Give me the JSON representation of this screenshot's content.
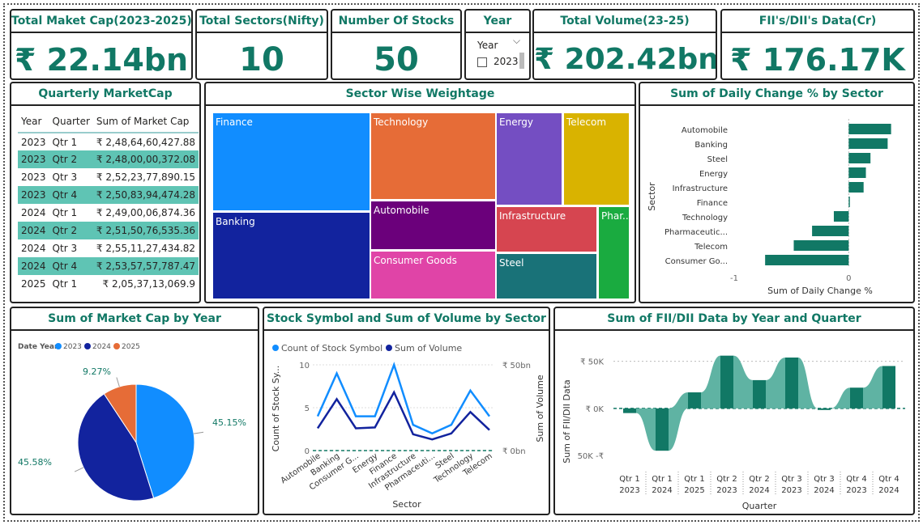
{
  "kpis": {
    "total_market_cap": {
      "title": "Total Maket Cap(2023-2025)",
      "value": "₹ 22.14bn"
    },
    "total_sectors": {
      "title": "Total Sectors(Nifty)",
      "value": "10"
    },
    "number_of_stocks": {
      "title": "Number Of Stocks",
      "value": "50"
    },
    "total_volume": {
      "title": "Total Volume(23-25)",
      "value": "₹ 202.42bn"
    },
    "fii_dii": {
      "title": "FII's/DII's Data(Cr)",
      "value": "₹ 176.17K"
    }
  },
  "year_slicer": {
    "title": "Year",
    "label": "Year",
    "chevron": "⌵",
    "option": "2023"
  },
  "quarterly_table": {
    "title": "Quarterly MarketCap",
    "headers": [
      "Year",
      "Quarter",
      "Sum of Market Cap"
    ],
    "rows": [
      [
        "2023",
        "Qtr 1",
        "₹ 2,48,64,60,427.88"
      ],
      [
        "2023",
        "Qtr 2",
        "₹ 2,48,00,00,372.08"
      ],
      [
        "2023",
        "Qtr 3",
        "₹ 2,52,23,77,890.15"
      ],
      [
        "2023",
        "Qtr 4",
        "₹ 2,50,83,94,474.28"
      ],
      [
        "2024",
        "Qtr 1",
        "₹ 2,49,00,06,874.36"
      ],
      [
        "2024",
        "Qtr 2",
        "₹ 2,51,50,76,535.36"
      ],
      [
        "2024",
        "Qtr 3",
        "₹ 2,55,11,27,434.82"
      ],
      [
        "2024",
        "Qtr 4",
        "₹ 2,53,57,57,787.47"
      ],
      [
        "2025",
        "Qtr 1",
        "₹ 2,05,37,13,069.9"
      ]
    ]
  },
  "treemap": {
    "title": "Sector Wise Weightage",
    "tiles": [
      {
        "label": "Finance",
        "color": "#118DFF"
      },
      {
        "label": "Banking",
        "color": "#12239E"
      },
      {
        "label": "Technology",
        "color": "#E66C37"
      },
      {
        "label": "Automobile",
        "color": "#6B007B"
      },
      {
        "label": "Consumer Goods",
        "color": "#E044A7"
      },
      {
        "label": "Energy",
        "color": "#744EC2"
      },
      {
        "label": "Telecom",
        "color": "#D9B300"
      },
      {
        "label": "Infrastructure",
        "color": "#D64550"
      },
      {
        "label": "Steel",
        "color": "#197278"
      },
      {
        "label": "Phar...",
        "color": "#1AAB40"
      }
    ]
  },
  "daily_change": {
    "title": "Sum of Daily Change % by Sector",
    "ylabel": "Sector",
    "xlabel": "Sum of Daily Change %",
    "ticks": [
      "-1",
      "0"
    ],
    "color": "#117865",
    "categories": [
      "Automobile",
      "Banking",
      "Steel",
      "Energy",
      "Infrastructure",
      "Finance",
      "Technology",
      "Pharmaceutic...",
      "Telecom",
      "Consumer Go..."
    ]
  },
  "pie": {
    "title": "Sum of Market Cap by Year",
    "legend_title": "Date Year",
    "legend": [
      {
        "label": "2023",
        "color": "#118DFF"
      },
      {
        "label": "2024",
        "color": "#12239E"
      },
      {
        "label": "2025",
        "color": "#E66C37"
      }
    ],
    "labels": [
      "45.15%",
      "45.58%",
      "9.27%"
    ]
  },
  "volume_chart": {
    "title": "Stock Symbol and Sum of Volume by Sector",
    "legend": [
      {
        "label": "Count of Stock Symbol",
        "color": "#118DFF"
      },
      {
        "label": "Sum of Volume",
        "color": "#12239E"
      }
    ],
    "ylabel_left": "Count of Stock Sy...",
    "ylabel_right": "Sum of Volume",
    "xlabel": "Sector",
    "left_ticks": [
      "0",
      "5",
      "10"
    ],
    "right_ticks": [
      "₹ 0bn",
      "₹ 50bn"
    ],
    "categories": [
      "Automobile",
      "Banking",
      "Consumer G...",
      "Energy",
      "Finance",
      "Infrastructure",
      "Pharmaceuti...",
      "Steel",
      "Technology",
      "Telecom"
    ]
  },
  "fii_chart": {
    "title": "Sum of FII/DII Data by Year and Quarter",
    "ylabel": "Sum of FII/DII Data",
    "xlabel": "Quarter",
    "ticks": [
      "₹ 50K",
      "₹ 0K",
      "50K -₹"
    ],
    "color": "#117865",
    "ribbon_color": "#5fb3a3",
    "quarters": [
      "Qtr 1",
      "Qtr 1",
      "Qtr 1",
      "Qtr 2",
      "Qtr 2",
      "Qtr 3",
      "Qtr 3",
      "Qtr 4",
      "Qtr 4"
    ],
    "years": [
      "2023",
      "2024",
      "2025",
      "2023",
      "2024",
      "2023",
      "2024",
      "2023",
      "2024"
    ]
  },
  "chart_data": [
    {
      "type": "bar",
      "title": "Sum of Daily Change % by Sector",
      "xlabel": "Sum of Daily Change %",
      "ylabel": "Sector",
      "orientation": "horizontal",
      "categories": [
        "Automobile",
        "Banking",
        "Steel",
        "Energy",
        "Infrastructure",
        "Finance",
        "Technology",
        "Pharmaceutic...",
        "Telecom",
        "Consumer Go..."
      ],
      "values": [
        0.37,
        0.34,
        0.19,
        0.15,
        0.13,
        0.01,
        -0.13,
        -0.32,
        -0.48,
        -0.73
      ],
      "xlim": [
        -1,
        0.5
      ]
    },
    {
      "type": "pie",
      "title": "Sum of Market Cap by Year",
      "categories": [
        "2023",
        "2024",
        "2025"
      ],
      "values": [
        45.15,
        45.58,
        9.27
      ]
    },
    {
      "type": "line",
      "title": "Stock Symbol and Sum of Volume by Sector",
      "categories": [
        "Automobile",
        "Banking",
        "Consumer G...",
        "Energy",
        "Finance",
        "Infrastructure",
        "Pharmaceuti...",
        "Steel",
        "Technology",
        "Telecom"
      ],
      "series": [
        {
          "name": "Count of Stock Symbol",
          "axis": "left",
          "values": [
            4,
            9,
            4,
            4,
            10,
            3,
            2,
            3,
            7,
            4
          ]
        },
        {
          "name": "Sum of Volume",
          "axis": "right",
          "values": [
            26,
            60,
            26,
            27,
            68,
            19,
            13,
            20,
            45,
            24
          ]
        }
      ],
      "ylim_left": [
        0,
        10
      ],
      "ylim_right": [
        0,
        100
      ]
    },
    {
      "type": "bar",
      "title": "Sum of FII/DII Data by Year and Quarter",
      "xlabel": "Quarter",
      "ylabel": "Sum of FII/DII Data",
      "categories": [
        "Qtr 1 2023",
        "Qtr 1 2024",
        "Qtr 1 2025",
        "Qtr 2 2023",
        "Qtr 2 2024",
        "Qtr 3 2023",
        "Qtr 3 2024",
        "Qtr 4 2023",
        "Qtr 4 2024"
      ],
      "values": [
        -5000,
        -45000,
        17000,
        56000,
        30000,
        54000,
        0,
        22000,
        45000
      ],
      "ylim": [
        -50000,
        60000
      ]
    }
  ]
}
